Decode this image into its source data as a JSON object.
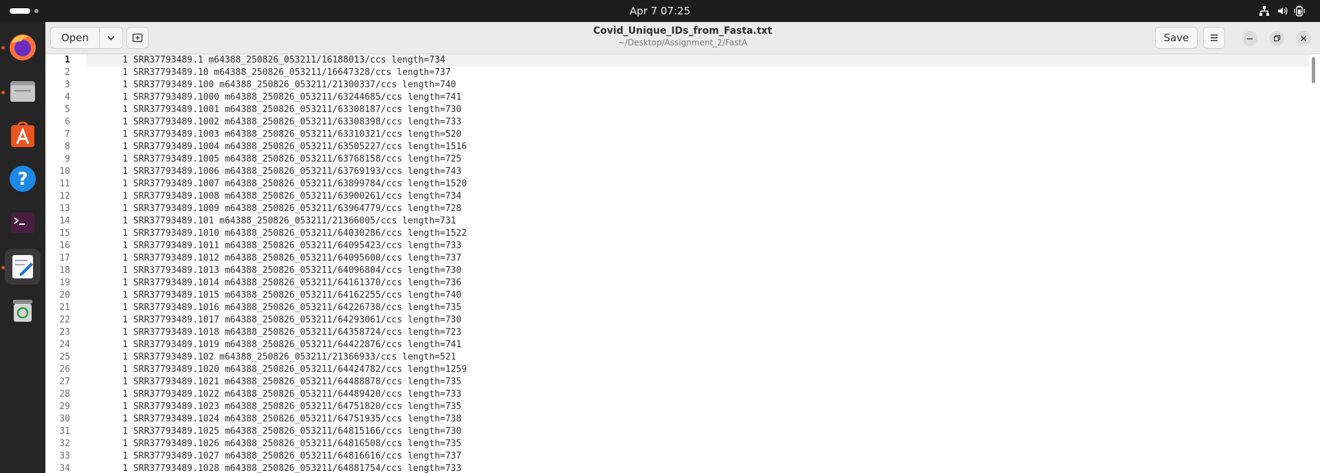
{
  "topbar": {
    "clock": "Apr 7  07:25",
    "icons": [
      "network-icon",
      "volume-icon",
      "battery-icon"
    ]
  },
  "dock": {
    "items": [
      "firefox-icon",
      "files-icon",
      "app-center-icon",
      "help-icon",
      "terminal-icon",
      "text-editor-icon",
      "trash-icon"
    ]
  },
  "header": {
    "open_label": "Open",
    "title": "Covid_Unique_IDs_from_Fasta.txt",
    "subtitle": "~/Desktop/Assignment_2/FastA",
    "save_label": "Save"
  },
  "editor": {
    "current_line": 1,
    "lines": [
      {
        "n": "1",
        "text": "     1 SRR37793489.1 m64388_250826_053211/16188013/ccs length=734"
      },
      {
        "n": "2",
        "text": "     1 SRR37793489.10 m64388_250826_053211/16647328/ccs length=737"
      },
      {
        "n": "3",
        "text": "     1 SRR37793489.100 m64388_250826_053211/21300337/ccs length=740"
      },
      {
        "n": "4",
        "text": "     1 SRR37793489.1000 m64388_250826_053211/63244685/ccs length=741"
      },
      {
        "n": "5",
        "text": "     1 SRR37793489.1001 m64388_250826_053211/63308187/ccs length=730"
      },
      {
        "n": "6",
        "text": "     1 SRR37793489.1002 m64388_250826_053211/63308398/ccs length=733"
      },
      {
        "n": "7",
        "text": "     1 SRR37793489.1003 m64388_250826_053211/63310321/ccs length=520"
      },
      {
        "n": "8",
        "text": "     1 SRR37793489.1004 m64388_250826_053211/63505227/ccs length=1516"
      },
      {
        "n": "9",
        "text": "     1 SRR37793489.1005 m64388_250826_053211/63768158/ccs length=725"
      },
      {
        "n": "10",
        "text": "     1 SRR37793489.1006 m64388_250826_053211/63769193/ccs length=743"
      },
      {
        "n": "11",
        "text": "     1 SRR37793489.1007 m64388_250826_053211/63899784/ccs length=1520"
      },
      {
        "n": "12",
        "text": "     1 SRR37793489.1008 m64388_250826_053211/63900261/ccs length=734"
      },
      {
        "n": "13",
        "text": "     1 SRR37793489.1009 m64388_250826_053211/63964779/ccs length=728"
      },
      {
        "n": "14",
        "text": "     1 SRR37793489.101 m64388_250826_053211/21366005/ccs length=731"
      },
      {
        "n": "15",
        "text": "     1 SRR37793489.1010 m64388_250826_053211/64030286/ccs length=1522"
      },
      {
        "n": "16",
        "text": "     1 SRR37793489.1011 m64388_250826_053211/64095423/ccs length=733"
      },
      {
        "n": "17",
        "text": "     1 SRR37793489.1012 m64388_250826_053211/64095600/ccs length=737"
      },
      {
        "n": "18",
        "text": "     1 SRR37793489.1013 m64388_250826_053211/64096804/ccs length=730"
      },
      {
        "n": "19",
        "text": "     1 SRR37793489.1014 m64388_250826_053211/64161370/ccs length=736"
      },
      {
        "n": "20",
        "text": "     1 SRR37793489.1015 m64388_250826_053211/64162255/ccs length=740"
      },
      {
        "n": "21",
        "text": "     1 SRR37793489.1016 m64388_250826_053211/64226738/ccs length=735"
      },
      {
        "n": "22",
        "text": "     1 SRR37793489.1017 m64388_250826_053211/64293061/ccs length=730"
      },
      {
        "n": "23",
        "text": "     1 SRR37793489.1018 m64388_250826_053211/64358724/ccs length=723"
      },
      {
        "n": "24",
        "text": "     1 SRR37793489.1019 m64388_250826_053211/64422876/ccs length=741"
      },
      {
        "n": "25",
        "text": "     1 SRR37793489.102 m64388_250826_053211/21366933/ccs length=521"
      },
      {
        "n": "26",
        "text": "     1 SRR37793489.1020 m64388_250826_053211/64424782/ccs length=1259"
      },
      {
        "n": "27",
        "text": "     1 SRR37793489.1021 m64388_250826_053211/64488878/ccs length=735"
      },
      {
        "n": "28",
        "text": "     1 SRR37793489.1022 m64388_250826_053211/64489420/ccs length=733"
      },
      {
        "n": "29",
        "text": "     1 SRR37793489.1023 m64388_250826_053211/64751820/ccs length=735"
      },
      {
        "n": "30",
        "text": "     1 SRR37793489.1024 m64388_250826_053211/64751935/ccs length=738"
      },
      {
        "n": "31",
        "text": "     1 SRR37793489.1025 m64388_250826_053211/64815166/ccs length=730"
      },
      {
        "n": "32",
        "text": "     1 SRR37793489.1026 m64388_250826_053211/64816508/ccs length=735"
      },
      {
        "n": "33",
        "text": "     1 SRR37793489.1027 m64388_250826_053211/64816616/ccs length=737"
      },
      {
        "n": "34",
        "text": "     1 SRR37793489.1028 m64388_250826_053211/64881754/ccs length=733"
      }
    ]
  }
}
